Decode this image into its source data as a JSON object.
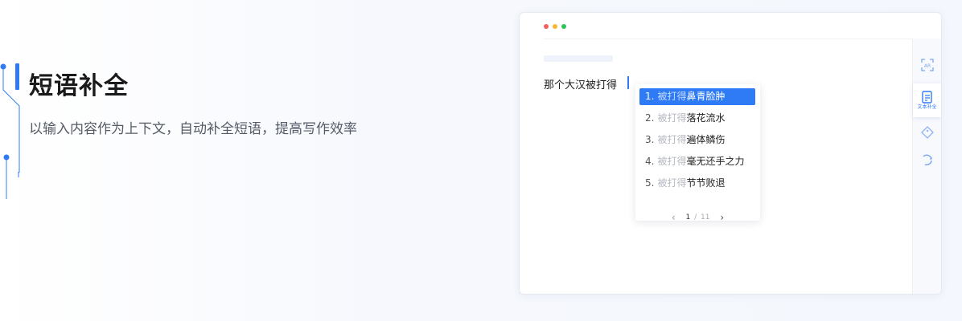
{
  "hero": {
    "title": "短语补全",
    "subtitle": "以输入内容作为上下文，自动补全短语，提高写作效率"
  },
  "colors": {
    "accent": "#2f7bf5",
    "dot_red": "#f25f5c",
    "dot_yellow": "#f7b731",
    "dot_green": "#2ec45c"
  },
  "editor": {
    "text": "那个大汉被打得"
  },
  "suggestions": [
    {
      "num": "1.",
      "prefix": "被打得",
      "completion": "鼻青脸肿",
      "selected": true
    },
    {
      "num": "2.",
      "prefix": "被打得",
      "completion": "落花流水",
      "selected": false
    },
    {
      "num": "3.",
      "prefix": "被打得",
      "completion": "遍体鳞伤",
      "selected": false
    },
    {
      "num": "4.",
      "prefix": "被打得",
      "completion": "毫无还手之力",
      "selected": false
    },
    {
      "num": "5.",
      "prefix": "被打得",
      "completion": "节节败退",
      "selected": false
    }
  ],
  "pager": {
    "current": "1",
    "separator": "/",
    "total": "11"
  },
  "side_panel": {
    "items": [
      {
        "icon": "text-recognition-icon"
      },
      {
        "icon": "document-edit-icon",
        "label": "文本补全",
        "active": true
      },
      {
        "icon": "tag-icon"
      },
      {
        "icon": "refresh-icon"
      }
    ]
  }
}
